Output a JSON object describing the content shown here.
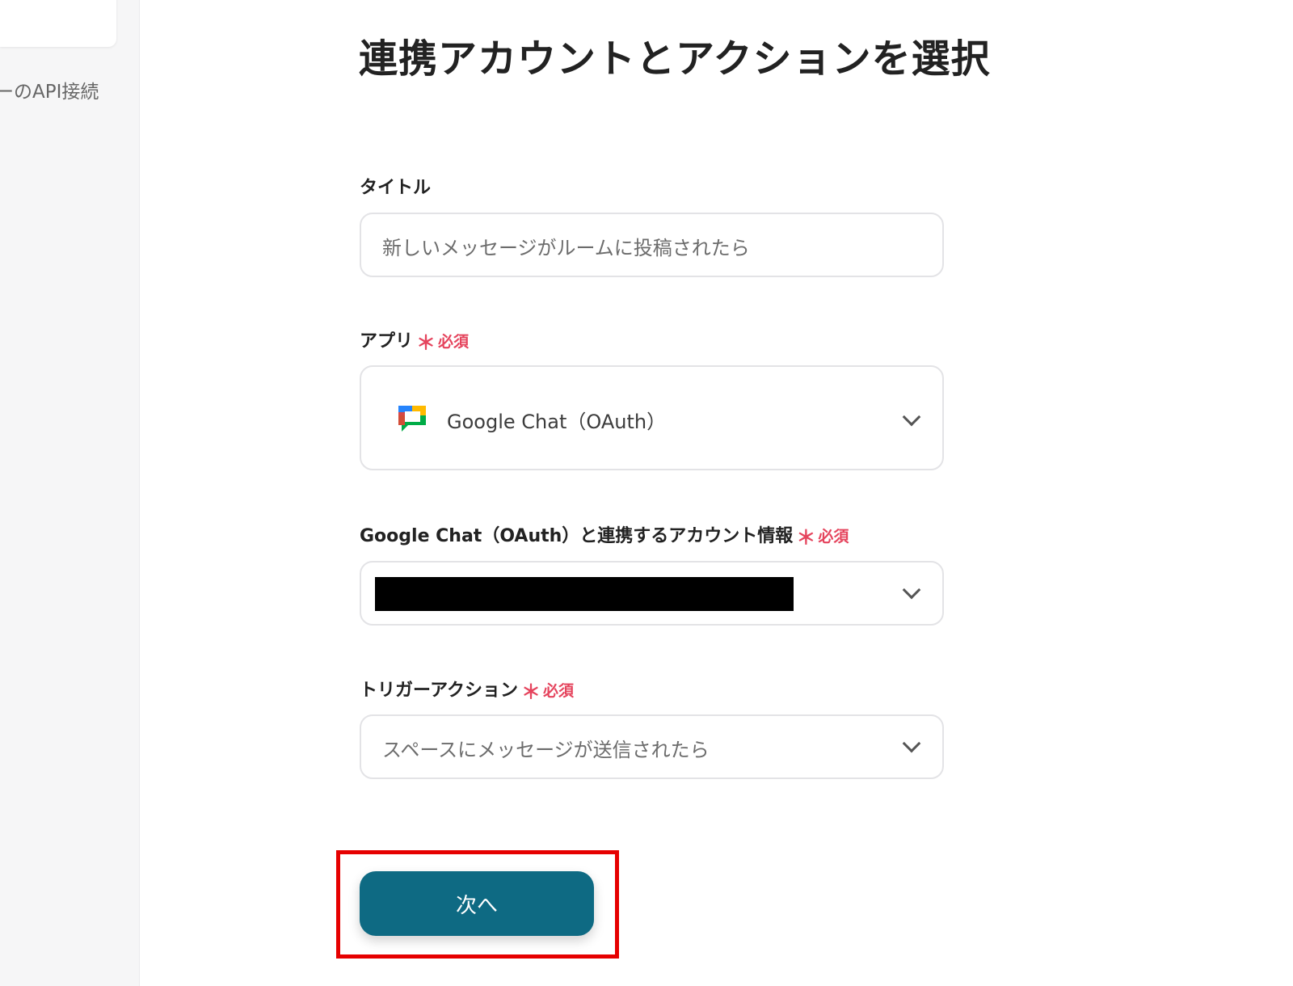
{
  "sidebar": {
    "link_text": "ーのAPI接続"
  },
  "page": {
    "title": "連携アカウントとアクションを選択"
  },
  "form": {
    "title_field": {
      "label": "タイトル",
      "value": "新しいメッセージがルームに投稿されたら"
    },
    "app_field": {
      "label": "アプリ",
      "required": "必須",
      "value": "Google Chat（OAuth）",
      "icon": "google-chat-icon"
    },
    "account_field": {
      "label": "Google Chat（OAuth）と連携するアカウント情報",
      "required": "必須"
    },
    "trigger_field": {
      "label": "トリガーアクション",
      "required": "必須",
      "value": "スペースにメッセージが送信されたら"
    },
    "required_mark": "＊"
  },
  "actions": {
    "next_label": "次へ"
  },
  "colors": {
    "primary_button": "#0e6a83",
    "required": "#e5445d",
    "highlight": "#e60000"
  }
}
